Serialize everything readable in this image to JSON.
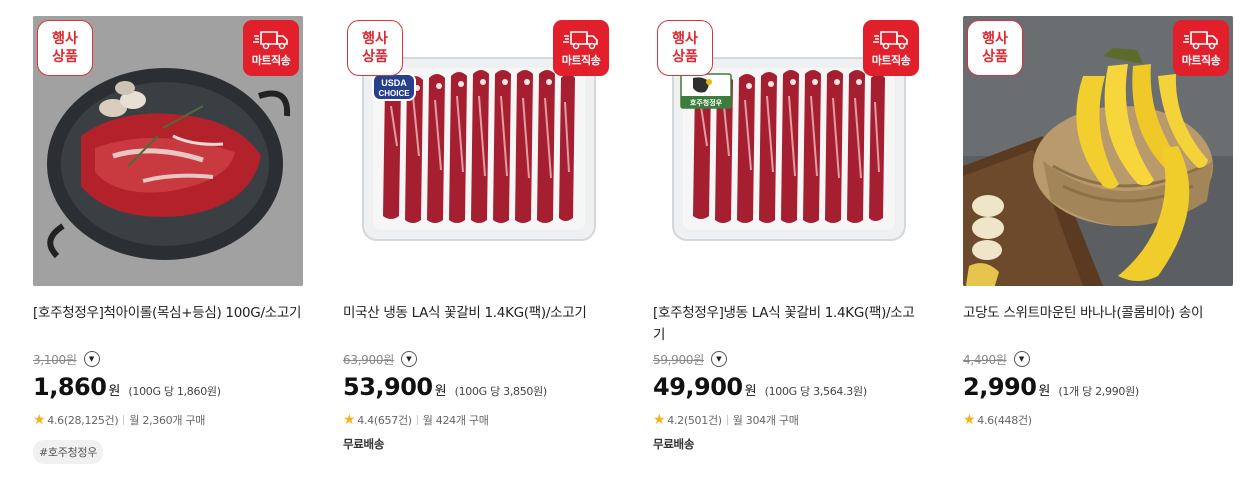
{
  "badges": {
    "event_line1": "행사",
    "event_line2": "상품",
    "mart": "마트직송"
  },
  "products": [
    {
      "name": "[호주청정우]척아이롤(목심+등심) 100G/소고기",
      "original_price": "3,100원",
      "price": "1,860",
      "won": "원",
      "unit_price": "(100G 당 1,860원)",
      "rating": "4.6",
      "reviews": "(28,125건)",
      "monthly": "월 2,360개 구매",
      "free_shipping": "",
      "tag": "#호주청정우",
      "image_icon": "beef-steak-on-plate"
    },
    {
      "name": "미국산 냉동 LA식 꽃갈비 1.4KG(팩)/소고기",
      "original_price": "63,900원",
      "price": "53,900",
      "won": "원",
      "unit_price": "(100G 당 3,850원)",
      "rating": "4.4",
      "reviews": "(657건)",
      "monthly": "월 424개 구매",
      "free_shipping": "무료배송",
      "tag": "",
      "image_icon": "packaged-la-galbi",
      "pack_label_line1": "USDA",
      "pack_label_line2": "CHOICE"
    },
    {
      "name": "[호주청정우]냉동 LA식 꽃갈비 1.4KG(팩)/소고기",
      "original_price": "59,900원",
      "price": "49,900",
      "won": "원",
      "unit_price": "(100G 당 3,564.3원)",
      "rating": "4.2",
      "reviews": "(501건)",
      "monthly": "월 304개 구매",
      "free_shipping": "무료배송",
      "tag": "",
      "image_icon": "packaged-la-galbi",
      "pack_label_line1": "호주청정우"
    },
    {
      "name": "고당도 스위트마운틴 바나나(콜롬비아) 송이",
      "original_price": "4,490원",
      "price": "2,990",
      "won": "원",
      "unit_price": "(1개 당 2,990원)",
      "rating": "4.6",
      "reviews": "(448건)",
      "monthly": "",
      "free_shipping": "",
      "tag": "",
      "image_icon": "banana-bunch-in-basket"
    }
  ],
  "colors": {
    "accent_red": "#e1202c",
    "star": "#f4b41a"
  }
}
